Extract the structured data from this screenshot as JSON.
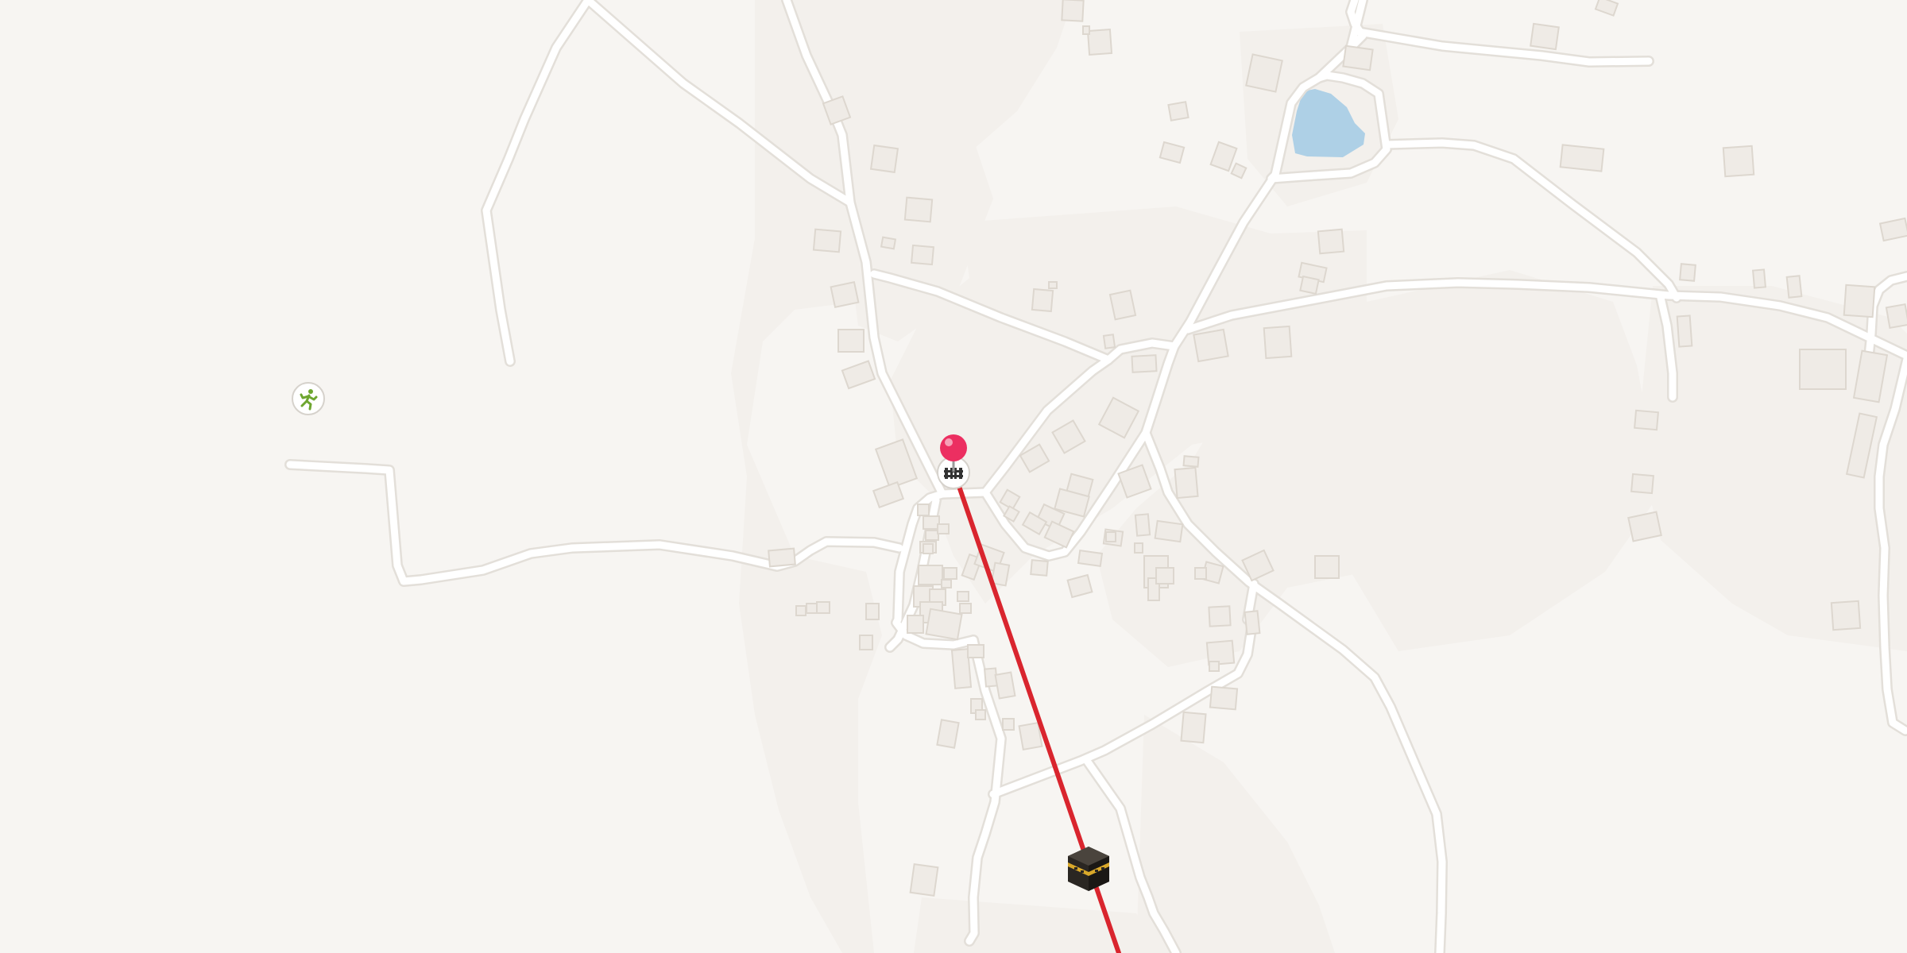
{
  "map": {
    "background_color": "#f7f5f2",
    "landuse_color": "#f3f0ec",
    "road_color": "#ffffff",
    "road_casing_color": "#e4e1dc",
    "building_color": "#efebe6",
    "building_shadow_color": "#dcd6cf",
    "water_color": "#aed0e6",
    "route_line_color": "#d9252e",
    "pin_color": "#ec2f61"
  },
  "markers": {
    "location_pin": {
      "icon": "map-pin-icon",
      "color": "#ec2f61"
    },
    "railway_poi": {
      "icon": "railway-crossing-icon"
    },
    "sports_poi": {
      "icon": "sports-running-icon",
      "color": "#6ea630"
    },
    "kaaba_marker": {
      "icon": "kaaba-icon"
    }
  }
}
